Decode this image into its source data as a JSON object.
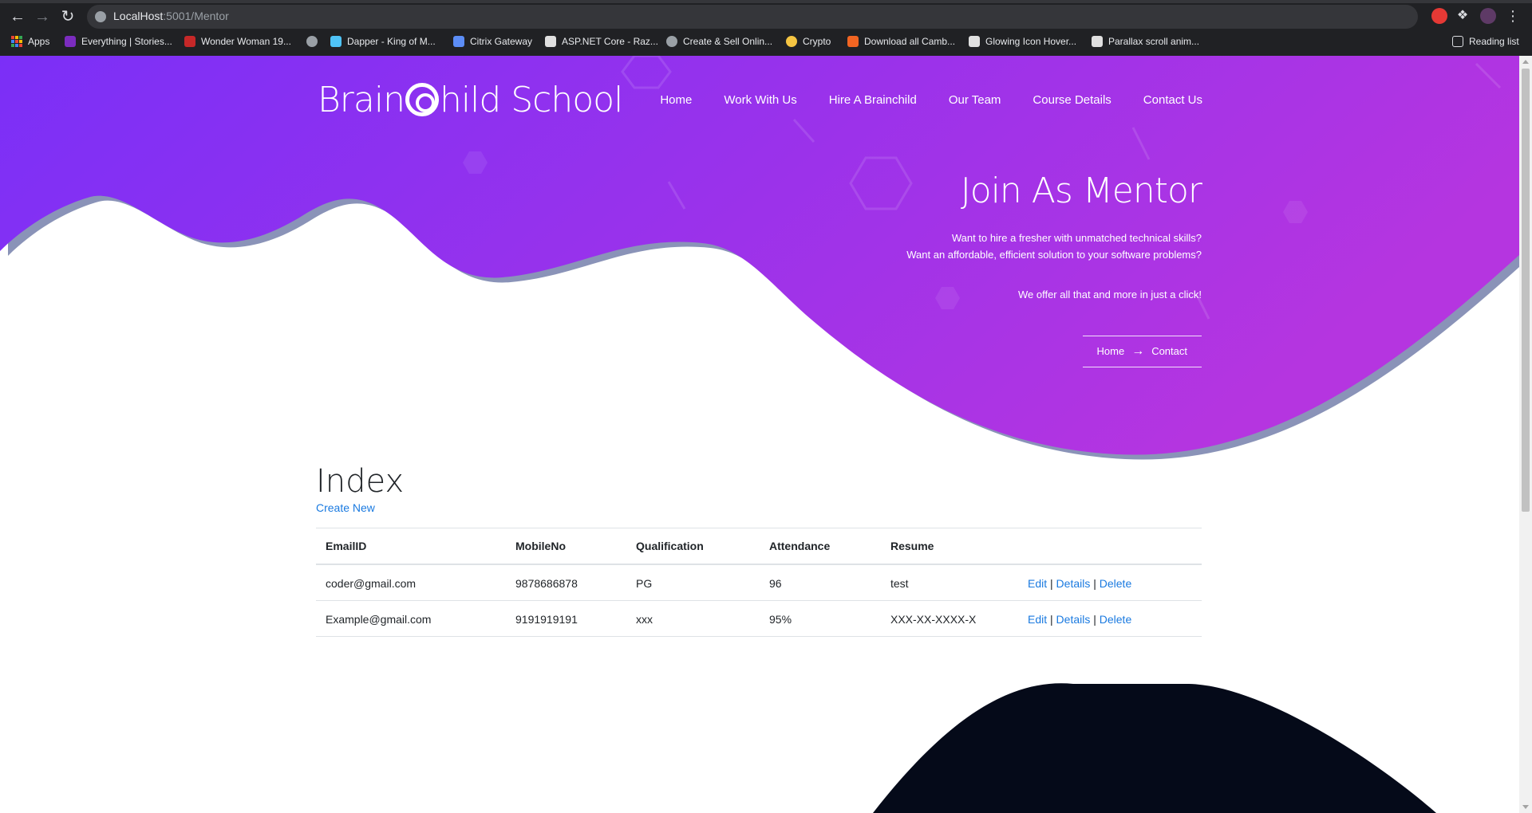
{
  "browser": {
    "url_host": "LocalHost",
    "url_path": ":5001/Mentor",
    "bookmarks": [
      {
        "label": "Apps",
        "color": "#4285f4"
      },
      {
        "label": "Everything | Stories...",
        "color": "#7b2cbf"
      },
      {
        "label": "Wonder Woman 19...",
        "color": "#c62828"
      },
      {
        "label": "",
        "color": "#9aa0a6"
      },
      {
        "label": "Dapper - King of M...",
        "color": "#4fc3f7"
      },
      {
        "label": "Citrix Gateway",
        "color": "#5c8df6"
      },
      {
        "label": "ASP.NET Core - Raz...",
        "color": "#e0e0e0"
      },
      {
        "label": "Create & Sell Onlin...",
        "color": "#9aa0a6"
      },
      {
        "label": "Crypto",
        "color": "#f5c542"
      },
      {
        "label": "Download all Camb...",
        "color": "#f26522"
      },
      {
        "label": "Glowing Icon Hover...",
        "color": "#e0e0e0"
      },
      {
        "label": "Parallax scroll anim...",
        "color": "#e0e0e0"
      }
    ],
    "reading_list": "Reading list"
  },
  "site": {
    "logo": {
      "part1": "Brain",
      "part2": "hild School"
    },
    "nav": [
      "Home",
      "Work With Us",
      "Hire A Brainchild",
      "Our Team",
      "Course Details",
      "Contact Us"
    ]
  },
  "hero": {
    "title": "Join As Mentor",
    "line1": "Want to hire a fresher with unmatched technical skills?",
    "line2": "Want an affordable, efficient solution to your software problems?",
    "line3": "We offer all that and more in just a click!",
    "breadcrumb_home": "Home",
    "breadcrumb_current": "Contact"
  },
  "content": {
    "heading": "Index",
    "create_new": "Create New",
    "columns": [
      "EmailID",
      "MobileNo",
      "Qualification",
      "Attendance",
      "Resume"
    ],
    "rows": [
      {
        "email": "coder@gmail.com",
        "mobile": "9878686878",
        "qualification": "PG",
        "attendance": "96",
        "resume": "test"
      },
      {
        "email": "Example@gmail.com",
        "mobile": "9191919191",
        "qualification": "xxx",
        "attendance": "95%",
        "resume": "XXX-XX-XXXX-X"
      }
    ],
    "actions": {
      "edit": "Edit",
      "details": "Details",
      "delete": "Delete",
      "sep": "|"
    }
  },
  "colors": {
    "hero_start": "#7b2ff7",
    "hero_end": "#b535e0",
    "link": "#1a7ae0",
    "dark_blob": "#050a19"
  }
}
